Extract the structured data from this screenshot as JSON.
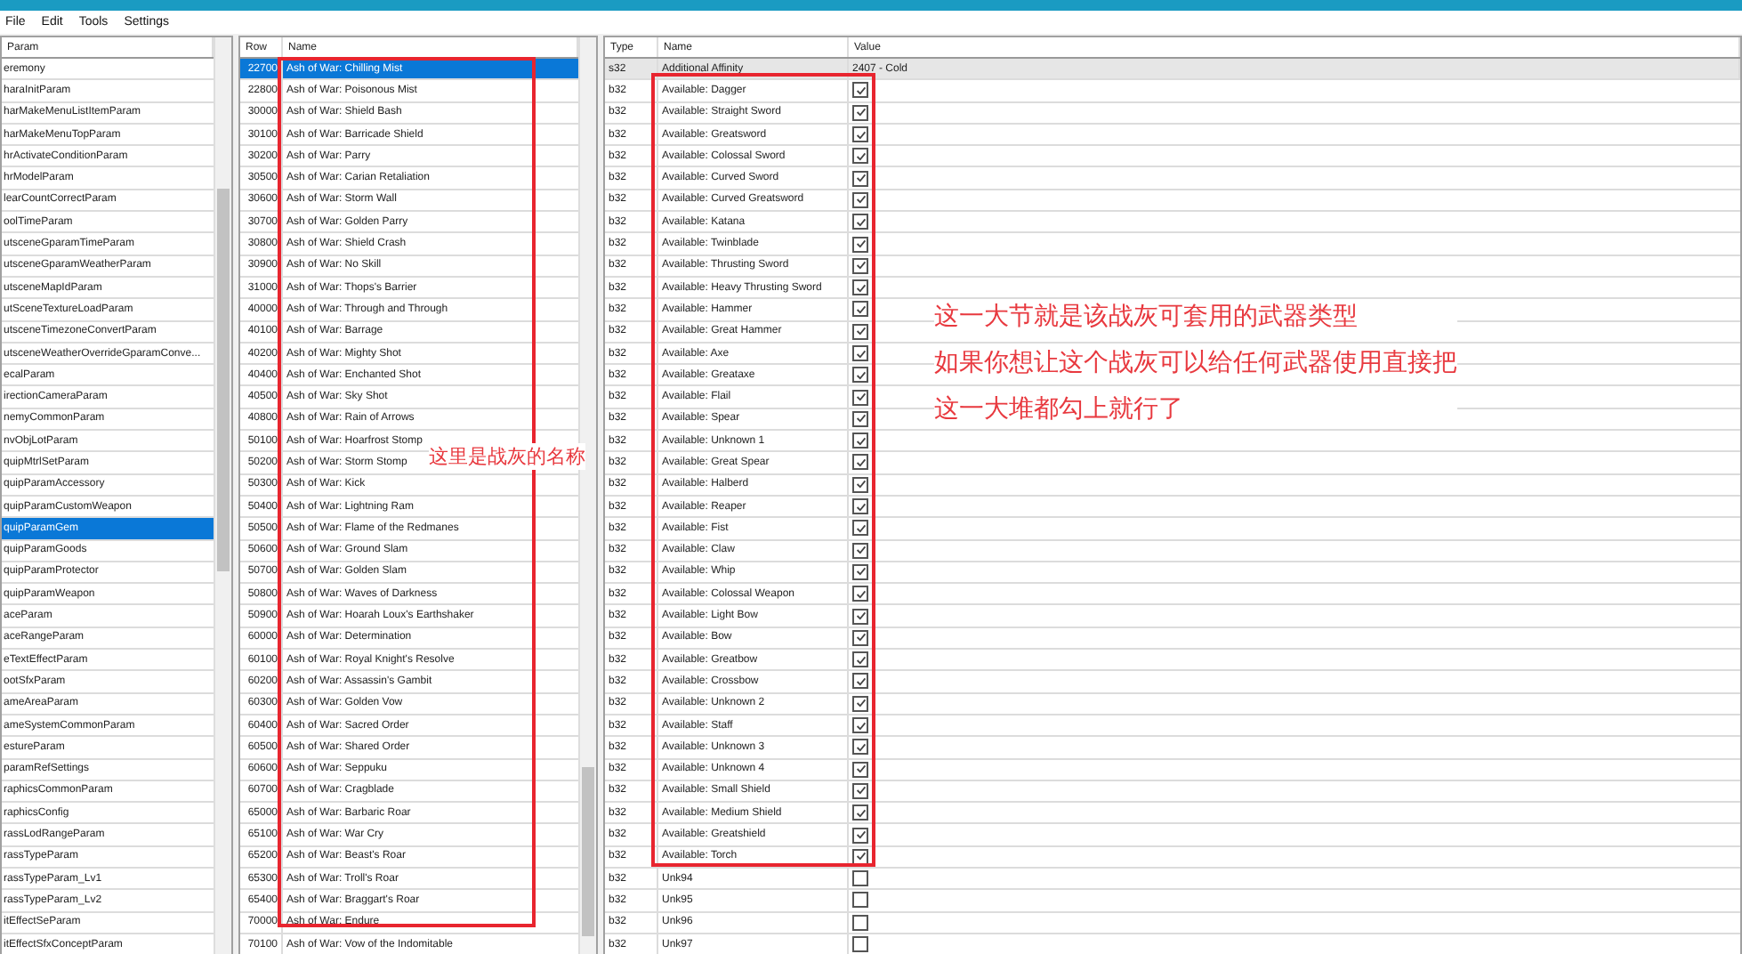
{
  "menu": [
    "File",
    "Edit",
    "Tools",
    "Settings"
  ],
  "params": {
    "header": "Param",
    "items": [
      {
        "label": "eremony",
        "selected": false
      },
      {
        "label": "haraInitParam",
        "selected": false
      },
      {
        "label": "harMakeMenuListItemParam",
        "selected": false
      },
      {
        "label": "harMakeMenuTopParam",
        "selected": false
      },
      {
        "label": "hrActivateConditionParam",
        "selected": false
      },
      {
        "label": "hrModelParam",
        "selected": false
      },
      {
        "label": "learCountCorrectParam",
        "selected": false
      },
      {
        "label": "oolTimeParam",
        "selected": false
      },
      {
        "label": "utsceneGparamTimeParam",
        "selected": false
      },
      {
        "label": "utsceneGparamWeatherParam",
        "selected": false
      },
      {
        "label": "utsceneMapIdParam",
        "selected": false
      },
      {
        "label": "utSceneTextureLoadParam",
        "selected": false
      },
      {
        "label": "utsceneTimezoneConvertParam",
        "selected": false
      },
      {
        "label": "utsceneWeatherOverrideGparamConve...",
        "selected": false
      },
      {
        "label": "ecalParam",
        "selected": false
      },
      {
        "label": "irectionCameraParam",
        "selected": false
      },
      {
        "label": "nemyCommonParam",
        "selected": false
      },
      {
        "label": "nvObjLotParam",
        "selected": false
      },
      {
        "label": "quipMtrlSetParam",
        "selected": false
      },
      {
        "label": "quipParamAccessory",
        "selected": false
      },
      {
        "label": "quipParamCustomWeapon",
        "selected": false
      },
      {
        "label": "quipParamGem",
        "selected": true
      },
      {
        "label": "quipParamGoods",
        "selected": false
      },
      {
        "label": "quipParamProtector",
        "selected": false
      },
      {
        "label": "quipParamWeapon",
        "selected": false
      },
      {
        "label": "aceParam",
        "selected": false
      },
      {
        "label": "aceRangeParam",
        "selected": false
      },
      {
        "label": "eTextEffectParam",
        "selected": false
      },
      {
        "label": "ootSfxParam",
        "selected": false
      },
      {
        "label": "ameAreaParam",
        "selected": false
      },
      {
        "label": "ameSystemCommonParam",
        "selected": false
      },
      {
        "label": "estureParam",
        "selected": false
      },
      {
        "label": "paramRefSettings",
        "selected": false
      },
      {
        "label": "raphicsCommonParam",
        "selected": false
      },
      {
        "label": "raphicsConfig",
        "selected": false
      },
      {
        "label": "rassLodRangeParam",
        "selected": false
      },
      {
        "label": "rassTypeParam",
        "selected": false
      },
      {
        "label": "rassTypeParam_Lv1",
        "selected": false
      },
      {
        "label": "rassTypeParam_Lv2",
        "selected": false
      },
      {
        "label": "itEffectSeParam",
        "selected": false
      },
      {
        "label": "itEffectSfxConceptParam",
        "selected": false
      }
    ]
  },
  "rows": {
    "columns": [
      "Row",
      "Name"
    ],
    "items": [
      {
        "id": "22700",
        "name": "Ash of War: Chilling Mist",
        "selected": true
      },
      {
        "id": "22800",
        "name": "Ash of War: Poisonous Mist",
        "selected": false
      },
      {
        "id": "30000",
        "name": "Ash of War: Shield Bash",
        "selected": false
      },
      {
        "id": "30100",
        "name": "Ash of War: Barricade Shield",
        "selected": false
      },
      {
        "id": "30200",
        "name": "Ash of War: Parry",
        "selected": false
      },
      {
        "id": "30500",
        "name": "Ash of War: Carian Retaliation",
        "selected": false
      },
      {
        "id": "30600",
        "name": "Ash of War: Storm Wall",
        "selected": false
      },
      {
        "id": "30700",
        "name": "Ash of War: Golden Parry",
        "selected": false
      },
      {
        "id": "30800",
        "name": "Ash of War: Shield Crash",
        "selected": false
      },
      {
        "id": "30900",
        "name": "Ash of War: No Skill",
        "selected": false
      },
      {
        "id": "31000",
        "name": "Ash of War: Thops's Barrier",
        "selected": false
      },
      {
        "id": "40000",
        "name": "Ash of War: Through and Through",
        "selected": false
      },
      {
        "id": "40100",
        "name": "Ash of War: Barrage",
        "selected": false
      },
      {
        "id": "40200",
        "name": "Ash of War: Mighty Shot",
        "selected": false
      },
      {
        "id": "40400",
        "name": "Ash of War: Enchanted Shot",
        "selected": false
      },
      {
        "id": "40500",
        "name": "Ash of War: Sky Shot",
        "selected": false
      },
      {
        "id": "40800",
        "name": "Ash of War: Rain of Arrows",
        "selected": false
      },
      {
        "id": "50100",
        "name": "Ash of War: Hoarfrost Stomp",
        "selected": false
      },
      {
        "id": "50200",
        "name": "Ash of War: Storm Stomp",
        "selected": false
      },
      {
        "id": "50300",
        "name": "Ash of War: Kick",
        "selected": false
      },
      {
        "id": "50400",
        "name": "Ash of War: Lightning Ram",
        "selected": false
      },
      {
        "id": "50500",
        "name": "Ash of War: Flame of the Redmanes",
        "selected": false
      },
      {
        "id": "50600",
        "name": "Ash of War: Ground Slam",
        "selected": false
      },
      {
        "id": "50700",
        "name": "Ash of War: Golden Slam",
        "selected": false
      },
      {
        "id": "50800",
        "name": "Ash of War: Waves of Darkness",
        "selected": false
      },
      {
        "id": "50900",
        "name": "Ash of War: Hoarah Loux's Earthshaker",
        "selected": false
      },
      {
        "id": "60000",
        "name": "Ash of War: Determination",
        "selected": false
      },
      {
        "id": "60100",
        "name": "Ash of War: Royal Knight's Resolve",
        "selected": false
      },
      {
        "id": "60200",
        "name": "Ash of War: Assassin's Gambit",
        "selected": false
      },
      {
        "id": "60300",
        "name": "Ash of War: Golden Vow",
        "selected": false
      },
      {
        "id": "60400",
        "name": "Ash of War: Sacred Order",
        "selected": false
      },
      {
        "id": "60500",
        "name": "Ash of War: Shared Order",
        "selected": false
      },
      {
        "id": "60600",
        "name": "Ash of War: Seppuku",
        "selected": false
      },
      {
        "id": "60700",
        "name": "Ash of War: Cragblade",
        "selected": false
      },
      {
        "id": "65000",
        "name": "Ash of War: Barbaric Roar",
        "selected": false
      },
      {
        "id": "65100",
        "name": "Ash of War: War Cry",
        "selected": false
      },
      {
        "id": "65200",
        "name": "Ash of War: Beast's Roar",
        "selected": false
      },
      {
        "id": "65300",
        "name": "Ash of War: Troll's Roar",
        "selected": false
      },
      {
        "id": "65400",
        "name": "Ash of War: Braggart's Roar",
        "selected": false
      },
      {
        "id": "70000",
        "name": "Ash of War: Endure",
        "selected": false
      },
      {
        "id": "70100",
        "name": "Ash of War: Vow of the Indomitable",
        "selected": false
      }
    ]
  },
  "fields": {
    "columns": [
      "Type",
      "Name",
      "Value"
    ],
    "items": [
      {
        "kind": "text",
        "type": "s32",
        "name": "Additional Affinity",
        "value": "2407 - Cold"
      },
      {
        "kind": "checkbox",
        "type": "b32",
        "name": "Available: Dagger",
        "checked": true
      },
      {
        "kind": "checkbox",
        "type": "b32",
        "name": "Available: Straight Sword",
        "checked": true
      },
      {
        "kind": "checkbox",
        "type": "b32",
        "name": "Available: Greatsword",
        "checked": true
      },
      {
        "kind": "checkbox",
        "type": "b32",
        "name": "Available: Colossal Sword",
        "checked": true
      },
      {
        "kind": "checkbox",
        "type": "b32",
        "name": "Available: Curved Sword",
        "checked": true
      },
      {
        "kind": "checkbox",
        "type": "b32",
        "name": "Available: Curved Greatsword",
        "checked": true
      },
      {
        "kind": "checkbox",
        "type": "b32",
        "name": "Available: Katana",
        "checked": true
      },
      {
        "kind": "checkbox",
        "type": "b32",
        "name": "Available: Twinblade",
        "checked": true
      },
      {
        "kind": "checkbox",
        "type": "b32",
        "name": "Available: Thrusting Sword",
        "checked": true
      },
      {
        "kind": "checkbox",
        "type": "b32",
        "name": "Available: Heavy Thrusting Sword",
        "checked": true
      },
      {
        "kind": "checkbox",
        "type": "b32",
        "name": "Available: Hammer",
        "checked": true
      },
      {
        "kind": "checkbox",
        "type": "b32",
        "name": "Available: Great Hammer",
        "checked": true
      },
      {
        "kind": "checkbox",
        "type": "b32",
        "name": "Available: Axe",
        "checked": true
      },
      {
        "kind": "checkbox",
        "type": "b32",
        "name": "Available: Greataxe",
        "checked": true
      },
      {
        "kind": "checkbox",
        "type": "b32",
        "name": "Available: Flail",
        "checked": true
      },
      {
        "kind": "checkbox",
        "type": "b32",
        "name": "Available: Spear",
        "checked": true
      },
      {
        "kind": "checkbox",
        "type": "b32",
        "name": "Available: Unknown 1",
        "checked": true
      },
      {
        "kind": "checkbox",
        "type": "b32",
        "name": "Available: Great Spear",
        "checked": true
      },
      {
        "kind": "checkbox",
        "type": "b32",
        "name": "Available: Halberd",
        "checked": true
      },
      {
        "kind": "checkbox",
        "type": "b32",
        "name": "Available: Reaper",
        "checked": true
      },
      {
        "kind": "checkbox",
        "type": "b32",
        "name": "Available: Fist",
        "checked": true
      },
      {
        "kind": "checkbox",
        "type": "b32",
        "name": "Available: Claw",
        "checked": true
      },
      {
        "kind": "checkbox",
        "type": "b32",
        "name": "Available: Whip",
        "checked": true
      },
      {
        "kind": "checkbox",
        "type": "b32",
        "name": "Available: Colossal Weapon",
        "checked": true
      },
      {
        "kind": "checkbox",
        "type": "b32",
        "name": "Available: Light Bow",
        "checked": true
      },
      {
        "kind": "checkbox",
        "type": "b32",
        "name": "Available: Bow",
        "checked": true
      },
      {
        "kind": "checkbox",
        "type": "b32",
        "name": "Available: Greatbow",
        "checked": true
      },
      {
        "kind": "checkbox",
        "type": "b32",
        "name": "Available: Crossbow",
        "checked": true
      },
      {
        "kind": "checkbox",
        "type": "b32",
        "name": "Available: Unknown 2",
        "checked": true
      },
      {
        "kind": "checkbox",
        "type": "b32",
        "name": "Available: Staff",
        "checked": true
      },
      {
        "kind": "checkbox",
        "type": "b32",
        "name": "Available: Unknown 3",
        "checked": true
      },
      {
        "kind": "checkbox",
        "type": "b32",
        "name": "Available: Unknown 4",
        "checked": true
      },
      {
        "kind": "checkbox",
        "type": "b32",
        "name": "Available: Small Shield",
        "checked": true
      },
      {
        "kind": "checkbox",
        "type": "b32",
        "name": "Available: Medium Shield",
        "checked": true
      },
      {
        "kind": "checkbox",
        "type": "b32",
        "name": "Available: Greatshield",
        "checked": true
      },
      {
        "kind": "checkbox",
        "type": "b32",
        "name": "Available: Torch",
        "checked": true
      },
      {
        "kind": "checkbox",
        "type": "b32",
        "name": "Unk94",
        "checked": false
      },
      {
        "kind": "checkbox",
        "type": "b32",
        "name": "Unk95",
        "checked": false
      },
      {
        "kind": "checkbox",
        "type": "b32",
        "name": "Unk96",
        "checked": false
      },
      {
        "kind": "checkbox",
        "type": "b32",
        "name": "Unk97",
        "checked": false
      }
    ]
  },
  "annotations": {
    "names_note": "这里是战灰的名称",
    "weapons_note": [
      "这一大节就是该战灰可套用的武器类型",
      "如果你想让这个战灰可以给任何武器使用直接把",
      "这一大堆都勾上就行了"
    ]
  }
}
